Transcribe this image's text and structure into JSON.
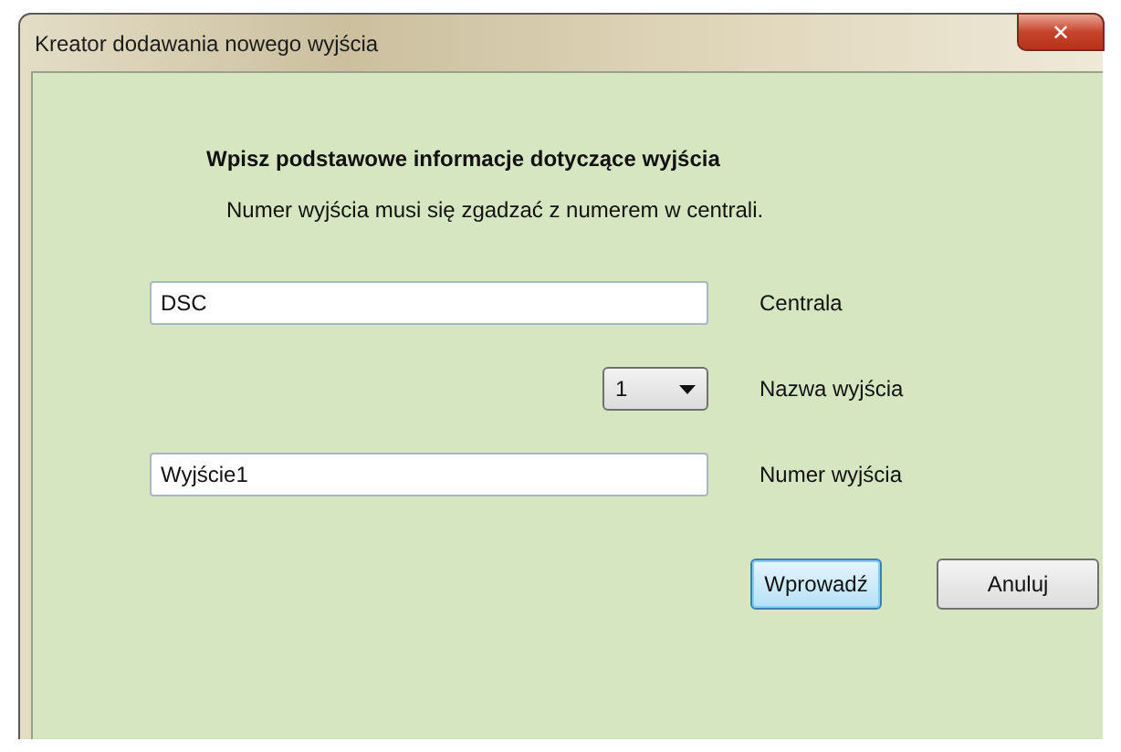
{
  "window": {
    "title": "Kreator dodawania nowego wyjścia",
    "close": "✕"
  },
  "heading": "Wpisz podstawowe informacje dotyczące wyjścia",
  "note": "Numer wyjścia musi się zgadzać z numerem w centrali.",
  "fields": [
    {
      "kind": "text",
      "value": "DSC",
      "label": "Centrala"
    },
    {
      "kind": "combo",
      "value": "1",
      "label": "Nazwa wyjścia"
    },
    {
      "kind": "text",
      "value": "Wyjście1",
      "label": "Numer wyjścia"
    }
  ],
  "buttons": [
    {
      "label": "Wprowadź",
      "default": true
    },
    {
      "label": "Anuluj",
      "default": false
    }
  ]
}
